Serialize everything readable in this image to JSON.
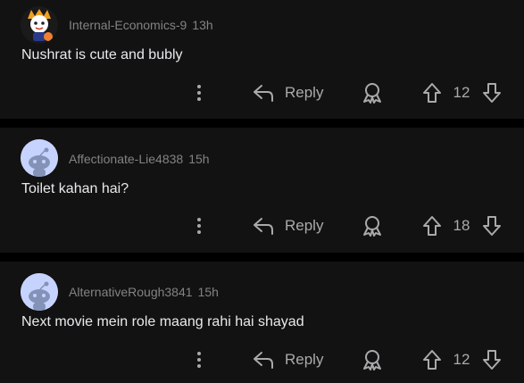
{
  "comments": [
    {
      "username": "Internal-Economics-9",
      "time": "13h",
      "text": "Nushrat is cute and bubly",
      "reply_label": "Reply",
      "votes": "12",
      "avatar": "custom-avatar"
    },
    {
      "username": "Affectionate-Lie4838",
      "time": "15h",
      "text": "Toilet kahan hai?",
      "reply_label": "Reply",
      "votes": "18",
      "avatar": "default-snoo-avatar"
    },
    {
      "username": "AlternativeRough3841",
      "time": "15h",
      "text": "Next movie mein role maang rahi hai shayad",
      "reply_label": "Reply",
      "votes": "12",
      "avatar": "default-snoo-avatar"
    }
  ],
  "colors": {
    "card_bg": "#121212",
    "page_bg": "#000000",
    "text": "#e8eaed",
    "meta": "#818384",
    "icon": "#a8aaab",
    "avatar_bg": "#c7d3ff"
  }
}
